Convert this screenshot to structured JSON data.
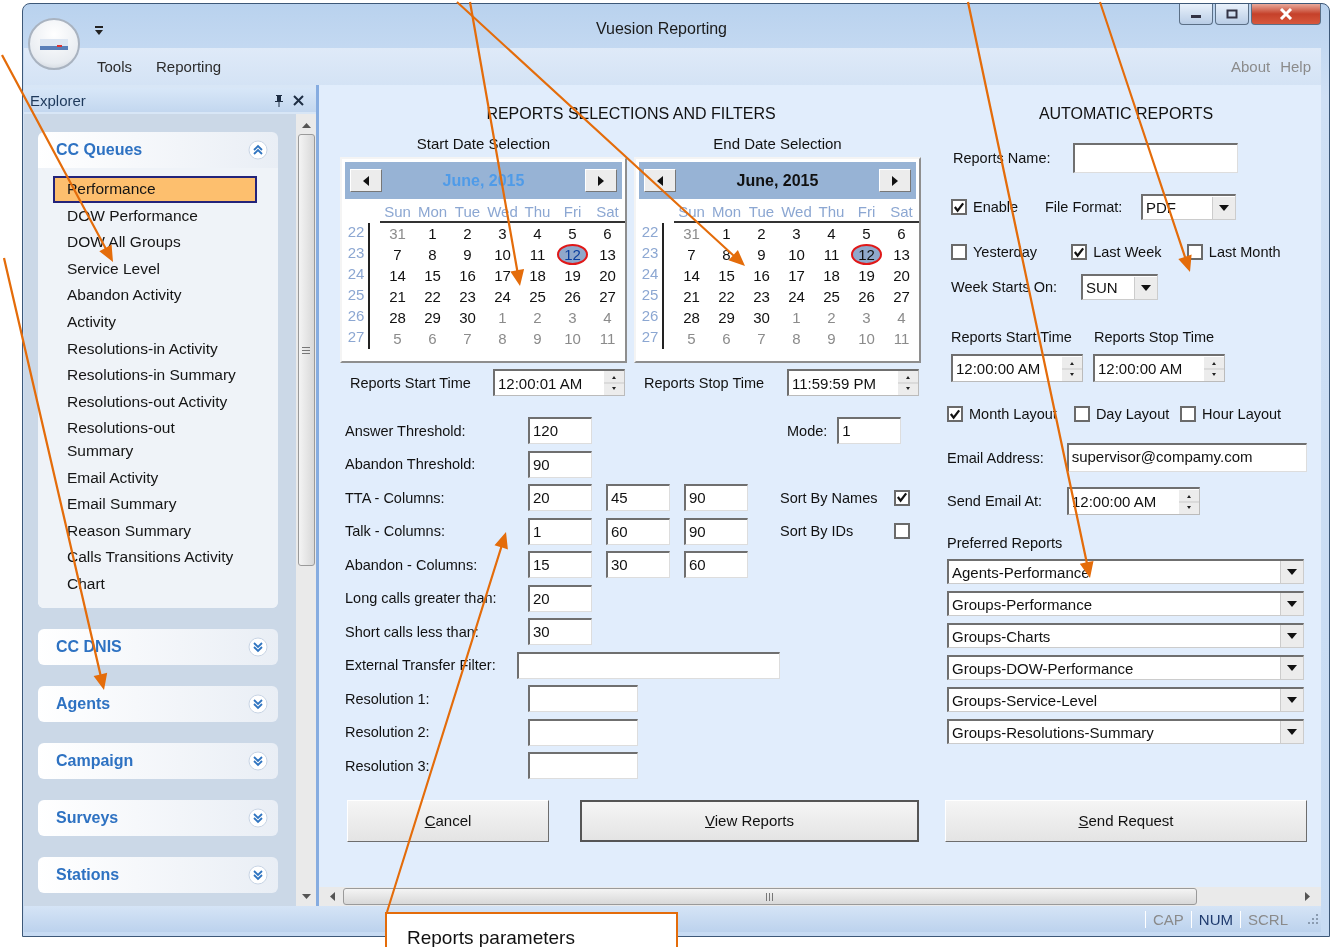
{
  "window": {
    "title": "Vuesion Reporting"
  },
  "menu": [
    "Tools",
    "Reporting"
  ],
  "help_links": [
    "About",
    "Help"
  ],
  "explorer": {
    "title": "Explorer",
    "groups": [
      {
        "title": "CC Queues",
        "expanded": true,
        "items": [
          {
            "label": "Performance",
            "selected": true
          },
          {
            "label": "DOW Performance",
            "selected": false
          },
          {
            "label": "DOW All Groups",
            "selected": false
          },
          {
            "label": "Service Level",
            "selected": false
          },
          {
            "label": "Abandon Activity",
            "selected": false
          },
          {
            "label": "Activity",
            "selected": false
          },
          {
            "label": "Resolutions-in Activity",
            "selected": false
          },
          {
            "label": "Resolutions-in Summary",
            "selected": false
          },
          {
            "label": "Resolutions-out Activity",
            "selected": false
          },
          {
            "label": "Resolutions-out Summary",
            "selected": false
          },
          {
            "label": "Email Activity",
            "selected": false
          },
          {
            "label": "Email Summary",
            "selected": false
          },
          {
            "label": "Reason Summary",
            "selected": false
          },
          {
            "label": "Calls Transitions Activity",
            "selected": false
          },
          {
            "label": "Chart",
            "selected": false
          }
        ]
      },
      {
        "title": "CC DNIS",
        "expanded": false
      },
      {
        "title": "Agents",
        "expanded": false
      },
      {
        "title": "Campaign",
        "expanded": false
      },
      {
        "title": "Surveys",
        "expanded": false
      },
      {
        "title": "Stations",
        "expanded": false
      }
    ]
  },
  "filters": {
    "title": "REPORTS SELECTIONS AND FILTERS",
    "calendars": [
      {
        "label": "Start Date Selection",
        "month": "June, 2015",
        "focused": true,
        "day_names": [
          "Sun",
          "Mon",
          "Tue",
          "Wed",
          "Thu",
          "Fri",
          "Sat"
        ],
        "weeks": [
          {
            "week": "22",
            "days": [
              {
                "label": "31",
                "muted": true,
                "selected": false
              },
              {
                "label": "1",
                "muted": false,
                "selected": false
              },
              {
                "label": "2",
                "muted": false,
                "selected": false
              },
              {
                "label": "3",
                "muted": false,
                "selected": false
              },
              {
                "label": "4",
                "muted": false,
                "selected": false
              },
              {
                "label": "5",
                "muted": false,
                "selected": false
              },
              {
                "label": "6",
                "muted": false,
                "selected": false
              }
            ]
          },
          {
            "week": "23",
            "days": [
              {
                "label": "7",
                "muted": false,
                "selected": false
              },
              {
                "label": "8",
                "muted": false,
                "selected": false
              },
              {
                "label": "9",
                "muted": false,
                "selected": false
              },
              {
                "label": "10",
                "muted": false,
                "selected": false
              },
              {
                "label": "11",
                "muted": false,
                "selected": false
              },
              {
                "label": "12",
                "muted": false,
                "selected": true
              },
              {
                "label": "13",
                "muted": false,
                "selected": false
              }
            ]
          },
          {
            "week": "24",
            "days": [
              {
                "label": "14",
                "muted": false,
                "selected": false
              },
              {
                "label": "15",
                "muted": false,
                "selected": false
              },
              {
                "label": "16",
                "muted": false,
                "selected": false
              },
              {
                "label": "17",
                "muted": false,
                "selected": false
              },
              {
                "label": "18",
                "muted": false,
                "selected": false
              },
              {
                "label": "19",
                "muted": false,
                "selected": false
              },
              {
                "label": "20",
                "muted": false,
                "selected": false
              }
            ]
          },
          {
            "week": "25",
            "days": [
              {
                "label": "21",
                "muted": false,
                "selected": false
              },
              {
                "label": "22",
                "muted": false,
                "selected": false
              },
              {
                "label": "23",
                "muted": false,
                "selected": false
              },
              {
                "label": "24",
                "muted": false,
                "selected": false
              },
              {
                "label": "25",
                "muted": false,
                "selected": false
              },
              {
                "label": "26",
                "muted": false,
                "selected": false
              },
              {
                "label": "27",
                "muted": false,
                "selected": false
              }
            ]
          },
          {
            "week": "26",
            "days": [
              {
                "label": "28",
                "muted": false,
                "selected": false
              },
              {
                "label": "29",
                "muted": false,
                "selected": false
              },
              {
                "label": "30",
                "muted": false,
                "selected": false
              },
              {
                "label": "1",
                "muted": true,
                "selected": false
              },
              {
                "label": "2",
                "muted": true,
                "selected": false
              },
              {
                "label": "3",
                "muted": true,
                "selected": false
              },
              {
                "label": "4",
                "muted": true,
                "selected": false
              }
            ]
          },
          {
            "week": "27",
            "days": [
              {
                "label": "5",
                "muted": true,
                "selected": false
              },
              {
                "label": "6",
                "muted": true,
                "selected": false
              },
              {
                "label": "7",
                "muted": true,
                "selected": false
              },
              {
                "label": "8",
                "muted": true,
                "selected": false
              },
              {
                "label": "9",
                "muted": true,
                "selected": false
              },
              {
                "label": "10",
                "muted": true,
                "selected": false
              },
              {
                "label": "11",
                "muted": true,
                "selected": false
              }
            ]
          }
        ]
      },
      {
        "label": "End Date Selection",
        "month": "June, 2015",
        "focused": false,
        "day_names": [
          "Sun",
          "Mon",
          "Tue",
          "Wed",
          "Thu",
          "Fri",
          "Sat"
        ],
        "weeks": [
          {
            "week": "22",
            "days": [
              {
                "label": "31",
                "muted": true,
                "selected": false
              },
              {
                "label": "1",
                "muted": false,
                "selected": false
              },
              {
                "label": "2",
                "muted": false,
                "selected": false
              },
              {
                "label": "3",
                "muted": false,
                "selected": false
              },
              {
                "label": "4",
                "muted": false,
                "selected": false
              },
              {
                "label": "5",
                "muted": false,
                "selected": false
              },
              {
                "label": "6",
                "muted": false,
                "selected": false
              }
            ]
          },
          {
            "week": "23",
            "days": [
              {
                "label": "7",
                "muted": false,
                "selected": false
              },
              {
                "label": "8",
                "muted": false,
                "selected": false
              },
              {
                "label": "9",
                "muted": false,
                "selected": false
              },
              {
                "label": "10",
                "muted": false,
                "selected": false
              },
              {
                "label": "11",
                "muted": false,
                "selected": false
              },
              {
                "label": "12",
                "muted": false,
                "selected": true
              },
              {
                "label": "13",
                "muted": false,
                "selected": false
              }
            ]
          },
          {
            "week": "24",
            "days": [
              {
                "label": "14",
                "muted": false,
                "selected": false
              },
              {
                "label": "15",
                "muted": false,
                "selected": false
              },
              {
                "label": "16",
                "muted": false,
                "selected": false
              },
              {
                "label": "17",
                "muted": false,
                "selected": false
              },
              {
                "label": "18",
                "muted": false,
                "selected": false
              },
              {
                "label": "19",
                "muted": false,
                "selected": false
              },
              {
                "label": "20",
                "muted": false,
                "selected": false
              }
            ]
          },
          {
            "week": "25",
            "days": [
              {
                "label": "21",
                "muted": false,
                "selected": false
              },
              {
                "label": "22",
                "muted": false,
                "selected": false
              },
              {
                "label": "23",
                "muted": false,
                "selected": false
              },
              {
                "label": "24",
                "muted": false,
                "selected": false
              },
              {
                "label": "25",
                "muted": false,
                "selected": false
              },
              {
                "label": "26",
                "muted": false,
                "selected": false
              },
              {
                "label": "27",
                "muted": false,
                "selected": false
              }
            ]
          },
          {
            "week": "26",
            "days": [
              {
                "label": "28",
                "muted": false,
                "selected": false
              },
              {
                "label": "29",
                "muted": false,
                "selected": false
              },
              {
                "label": "30",
                "muted": false,
                "selected": false
              },
              {
                "label": "1",
                "muted": true,
                "selected": false
              },
              {
                "label": "2",
                "muted": true,
                "selected": false
              },
              {
                "label": "3",
                "muted": true,
                "selected": false
              },
              {
                "label": "4",
                "muted": true,
                "selected": false
              }
            ]
          },
          {
            "week": "27",
            "days": [
              {
                "label": "5",
                "muted": true,
                "selected": false
              },
              {
                "label": "6",
                "muted": true,
                "selected": false
              },
              {
                "label": "7",
                "muted": true,
                "selected": false
              },
              {
                "label": "8",
                "muted": true,
                "selected": false
              },
              {
                "label": "9",
                "muted": true,
                "selected": false
              },
              {
                "label": "10",
                "muted": true,
                "selected": false
              },
              {
                "label": "11",
                "muted": true,
                "selected": false
              }
            ]
          }
        ]
      }
    ],
    "times": [
      {
        "label": "Reports Start Time",
        "value": "12:00:01 AM"
      },
      {
        "label": "Reports Stop Time",
        "value": "11:59:59 PM"
      }
    ],
    "fields": [
      {
        "label": "Answer Threshold:",
        "kind": "numbers",
        "values": [
          "120"
        ]
      },
      {
        "label": "Abandon Threshold:",
        "kind": "numbers",
        "values": [
          "90"
        ]
      },
      {
        "label": "TTA - Columns:",
        "kind": "numbers",
        "values": [
          "20",
          "45",
          "90"
        ]
      },
      {
        "label": "Talk - Columns:",
        "kind": "numbers",
        "values": [
          "1",
          "60",
          "90"
        ]
      },
      {
        "label": "Abandon - Columns:",
        "kind": "numbers",
        "values": [
          "15",
          "30",
          "60"
        ]
      },
      {
        "label": "Long calls greater than:",
        "kind": "numbers",
        "values": [
          "20"
        ]
      },
      {
        "label": "Short calls  less than:",
        "kind": "numbers",
        "values": [
          "30"
        ]
      },
      {
        "label": "External Transfer Filter:",
        "kind": "wide"
      },
      {
        "label": "Resolution 1:",
        "kind": "short"
      },
      {
        "label": "Resolution 2:",
        "kind": "short"
      },
      {
        "label": "Resolution 3:",
        "kind": "short"
      }
    ],
    "mode": {
      "label": "Mode:",
      "value": "1"
    },
    "sort_options": [
      {
        "label": "Sort By Names",
        "checked": true
      },
      {
        "label": "Sort By IDs",
        "checked": false
      }
    ]
  },
  "automatic": {
    "title": "AUTOMATIC REPORTS",
    "report_name": {
      "label": "Reports Name:"
    },
    "enable": {
      "label": "Enable",
      "checked": true
    },
    "file_format": {
      "label": "File Format:",
      "value": "PDF"
    },
    "periods": [
      {
        "label": "Yesterday",
        "checked": false
      },
      {
        "label": "Last Week",
        "checked": true
      },
      {
        "label": "Last Month",
        "checked": false
      }
    ],
    "week_start": {
      "label": "Week Starts On:",
      "value": "SUN"
    },
    "times": [
      {
        "label": "Reports Start Time",
        "value": "12:00:00 AM"
      },
      {
        "label": "Reports Stop Time",
        "value": "12:00:00 AM"
      }
    ],
    "layouts": [
      {
        "label": "Month Layout",
        "checked": true
      },
      {
        "label": "Day Layout",
        "checked": false
      },
      {
        "label": "Hour Layout",
        "checked": false
      }
    ],
    "email": {
      "label": "Email Address:",
      "value": "supervisor@compamy.com"
    },
    "send_at": {
      "label": "Send Email At:",
      "value": "12:00:00 AM"
    },
    "preferred": {
      "label": "Preferred Reports",
      "values": [
        "Agents-Performance",
        "Groups-Performance",
        "Groups-Charts",
        "Groups-DOW-Performance",
        "Groups-Service-Level",
        "Groups-Resolutions-Summary"
      ]
    }
  },
  "actions": [
    {
      "label": "Cancel",
      "access_key": true,
      "focused": false
    },
    {
      "label": "View Reports",
      "access_key": true,
      "focused": true
    },
    {
      "label": "Send Request",
      "access_key": true,
      "focused": false
    }
  ],
  "status_bar": [
    {
      "label": "CAP",
      "on": false
    },
    {
      "label": "NUM",
      "on": true
    },
    {
      "label": "SCRL",
      "on": false
    }
  ],
  "callout": {
    "text": "Reports parameters"
  }
}
